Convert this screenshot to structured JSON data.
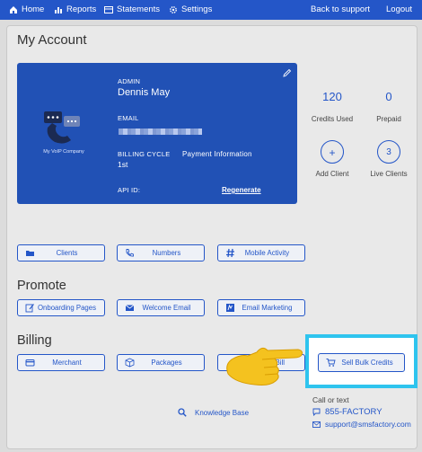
{
  "nav": {
    "home": "Home",
    "reports": "Reports",
    "statements": "Statements",
    "settings": "Settings",
    "back_to_support": "Back to support",
    "logout": "Logout"
  },
  "page_title": "My Account",
  "account": {
    "role": "ADMIN",
    "name": "Dennis May",
    "email_label": "EMAIL",
    "billing_cycle_label": "BILLING CYCLE",
    "billing_cycle_value": "1st",
    "payment_information": "Payment Information",
    "api_id_label": "API ID:",
    "regenerate": "Regenerate",
    "logo_text": "My VoIP Company"
  },
  "stats": {
    "credits_used_value": "120",
    "credits_used_label": "Credits Used",
    "prepaid_value": "0",
    "prepaid_label": "Prepaid",
    "add_client_symbol": "+",
    "add_client_label": "Add Client",
    "live_clients_value": "3",
    "live_clients_label": "Live Clients"
  },
  "actions": {
    "clients": "Clients",
    "numbers": "Numbers",
    "mobile_activity": "Mobile Activity"
  },
  "promote": {
    "title": "Promote",
    "onboarding_pages": "Onboarding Pages",
    "welcome_email": "Welcome Email",
    "email_marketing": "Email Marketing"
  },
  "billing": {
    "title": "Billing",
    "merchant": "Merchant",
    "packages": "Packages",
    "bill_partial": "Bill",
    "sell_bulk_credits": "Sell Bulk Credits"
  },
  "footer": {
    "knowledge_base": "Knowledge Base",
    "call_or_text": "Call or text",
    "phone": "855-FACTORY",
    "email": "support@smsfactory.com"
  },
  "colors": {
    "brand_blue": "#2456c8",
    "card_blue": "#2151b5",
    "highlight_cyan": "#2ec4ee"
  }
}
